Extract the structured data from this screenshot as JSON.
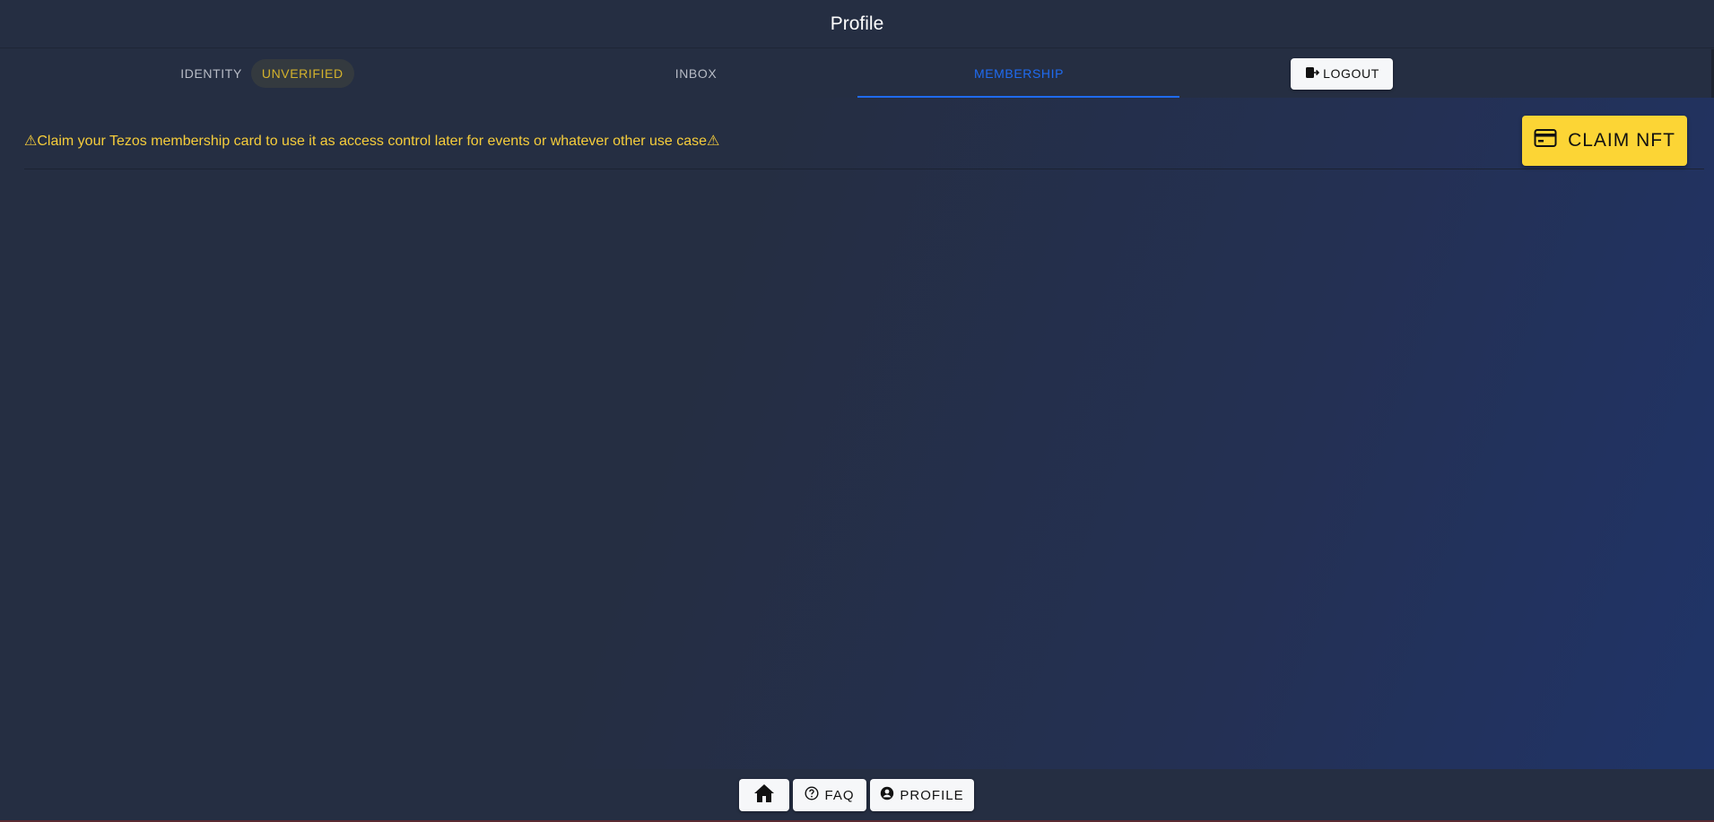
{
  "header": {
    "title": "Profile"
  },
  "tabs": {
    "identity": {
      "label": "IDENTITY",
      "badge": "UNVERIFIED"
    },
    "inbox": {
      "label": "INBOX"
    },
    "membership": {
      "label": "MEMBERSHIP",
      "active": true
    },
    "logout": {
      "label": "LOGOUT",
      "icon": "logout-icon"
    }
  },
  "membership": {
    "notice": "⚠Claim your Tezos membership card to use it as access control later for events or whatever other use case⚠",
    "claim_button": {
      "label": "CLAIM NFT",
      "icon": "credit-card-icon"
    }
  },
  "footer": {
    "home": {
      "icon": "home-icon"
    },
    "faq": {
      "label": "FAQ",
      "icon": "question-circle-icon"
    },
    "profile": {
      "label": "PROFILE",
      "icon": "account-circle-icon"
    }
  },
  "colors": {
    "background": "#252e42",
    "active_tab": "#1f6bf0",
    "warning_text": "#f6cd3b",
    "claim_button": "#fcd535",
    "badge_text": "#d4b22c"
  }
}
